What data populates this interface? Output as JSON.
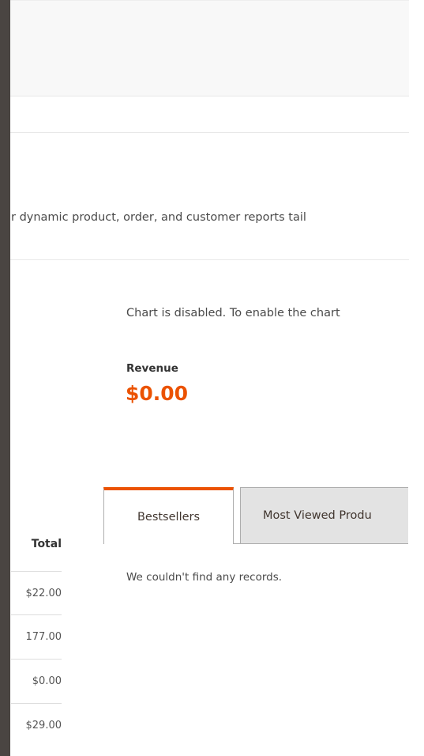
{
  "reports_intro": "r dynamic product, order, and customer reports tail",
  "chart": {
    "disabled_message": "Chart is disabled. To enable the chart"
  },
  "revenue": {
    "label": "Revenue",
    "value": "$0.00"
  },
  "tabs": [
    {
      "label": "Bestsellers",
      "active": true
    },
    {
      "label": "Most Viewed Produ",
      "active": false
    }
  ],
  "bestsellers_empty": "We couldn't find any records.",
  "orders_table": {
    "total_header": "Total",
    "rows": [
      "$22.00",
      "177.00",
      "$0.00",
      "$29.00"
    ]
  },
  "colors": {
    "accent": "#eb5202",
    "rail": "#4a4542"
  }
}
